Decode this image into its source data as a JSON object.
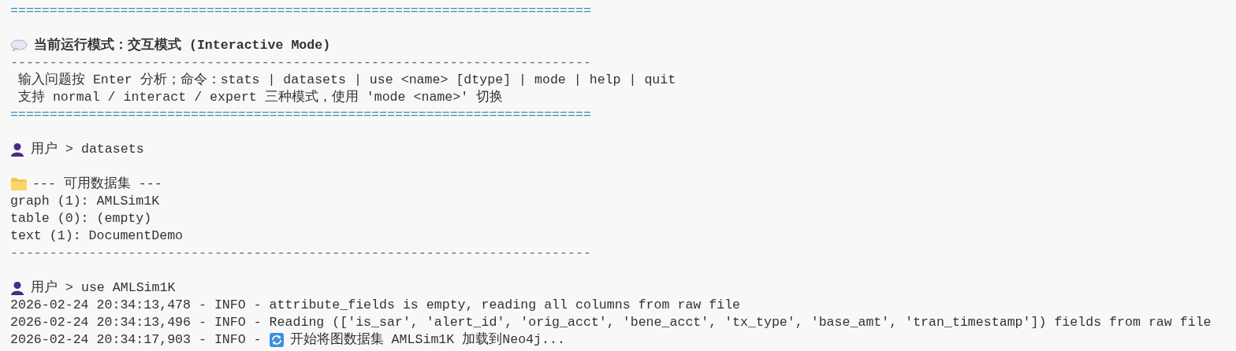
{
  "lines": [
    {
      "kind": "rule_double",
      "text": "=========================================================================="
    },
    {
      "kind": "blank"
    },
    {
      "kind": "heading",
      "text": "当前运行模式：交互模式 (Interactive Mode)"
    },
    {
      "kind": "rule_single",
      "text": "--------------------------------------------------------------------------"
    },
    {
      "kind": "text",
      "text": " 输入问题按 Enter 分析；命令：stats | datasets | use <name> [dtype] | mode | help | quit"
    },
    {
      "kind": "text",
      "text": " 支持 normal / interact / expert 三种模式，使用 'mode <name>' 切换"
    },
    {
      "kind": "rule_double",
      "text": "=========================================================================="
    },
    {
      "kind": "blank"
    },
    {
      "kind": "prompt",
      "prompt": "用户 >",
      "text": "datasets"
    },
    {
      "kind": "blank"
    },
    {
      "kind": "section",
      "text": "--- 可用数据集 ---"
    },
    {
      "kind": "text",
      "text": "graph (1): AMLSim1K"
    },
    {
      "kind": "text",
      "text": "table (0): (empty)"
    },
    {
      "kind": "text",
      "text": "text (1): DocumentDemo"
    },
    {
      "kind": "rule_single",
      "text": "--------------------------------------------------------------------------"
    },
    {
      "kind": "blank"
    },
    {
      "kind": "prompt",
      "prompt": "用户 >",
      "text": "use AMLSim1K"
    },
    {
      "kind": "text",
      "text": "2026-02-24 20:34:13,478 - INFO - attribute_fields is empty, reading all columns from raw file"
    },
    {
      "kind": "text",
      "text": "2026-02-24 20:34:13,496 - INFO - Reading (['is_sar', 'alert_id', 'orig_acct', 'bene_acct', 'tx_type', 'base_amt', 'tran_timestamp']) fields from raw file"
    },
    {
      "kind": "log_icon",
      "prefix": "2026-02-24 20:34:17,903 - INFO -",
      "text": "开始将图数据集 AMLSim1K 加载到Neo4j..."
    }
  ]
}
